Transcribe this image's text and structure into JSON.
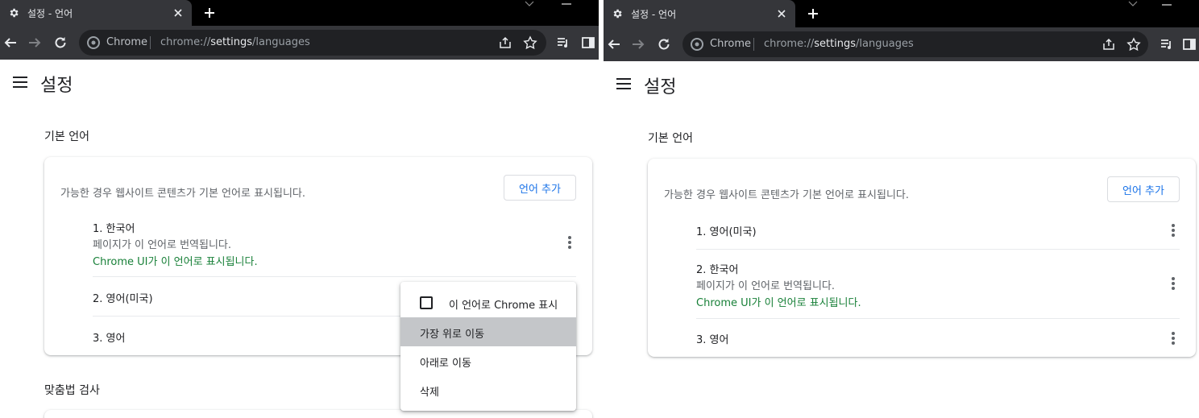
{
  "browser": {
    "tab_title": "설정 - 언어",
    "omnibox_chip": "Chrome",
    "url_prefix": "chrome://",
    "url_bold": "settings",
    "url_suffix": "/languages"
  },
  "settings": {
    "title": "설정",
    "section_languages": "기본 언어",
    "section_spellcheck": "맞춤법 검사",
    "description": "가능한 경우 웹사이트 콘텐츠가 기본 언어로 표시됩니다.",
    "add_language": "언어 추가",
    "translate_note": "페이지가 이 언어로 번역됩니다.",
    "ui_note": "Chrome UI가 이 언어로 표시됩니다."
  },
  "left": {
    "languages": [
      "1. 한국어",
      "2. 영어(미국)",
      "3. 영어"
    ]
  },
  "context_menu": {
    "items": [
      "이 언어로 Chrome 표시",
      "가장 위로 이동",
      "아래로 이동",
      "삭제"
    ],
    "highlighted_index": 1
  },
  "right": {
    "languages": [
      "1. 영어(미국)",
      "2. 한국어",
      "3. 영어"
    ]
  },
  "colors": {
    "accent": "#1a73e8",
    "ui_language_note": "#188038",
    "toolbar": "#35363a",
    "tabstrip": "#000000"
  }
}
